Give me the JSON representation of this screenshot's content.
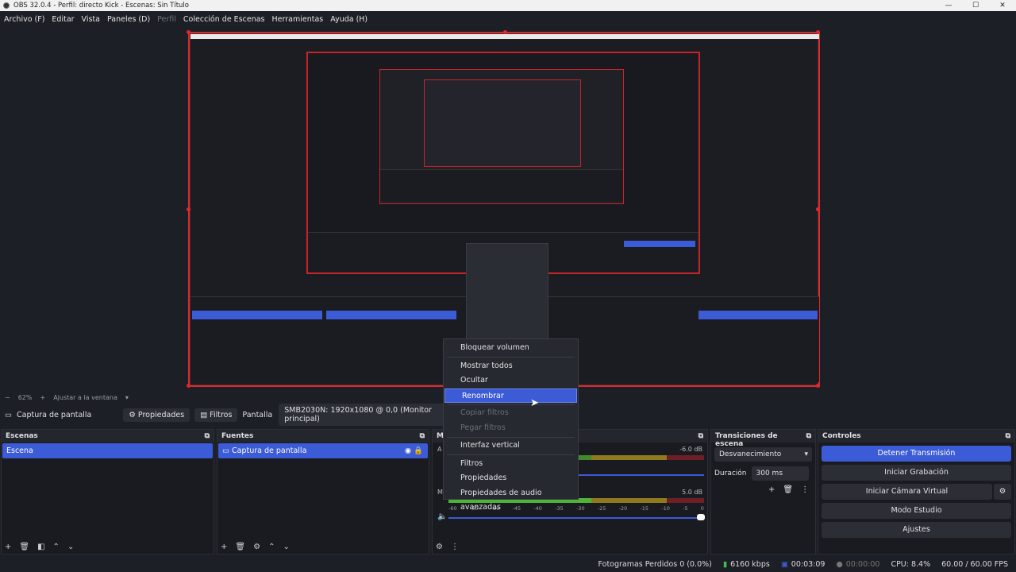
{
  "window": {
    "title": "OBS 32.0.4 - Perfil: directo Kick - Escenas: Sin Título",
    "min": "—",
    "max": "☐",
    "close": "✕"
  },
  "menubar": {
    "items": [
      "Archivo (F)",
      "Editar",
      "Vista",
      "Paneles (D)",
      "Perfil",
      "Colección de Escenas",
      "Herramientas",
      "Ayuda (H)"
    ]
  },
  "zoom": {
    "minus": "−",
    "value": "62%",
    "plus": "+",
    "fit": "Ajustar a la ventana"
  },
  "source_toolbar": {
    "source": "Captura de pantalla",
    "properties": "Propiedades",
    "filters": "Filtros",
    "display_label": "Pantalla",
    "display_value": "SMB2030N: 1920x1080 @ 0,0 (Monitor principal)"
  },
  "scenes": {
    "title": "Escenas",
    "items": [
      "Escena"
    ]
  },
  "sources": {
    "title": "Fuentes",
    "items": [
      "Captura de pantalla"
    ]
  },
  "mixer": {
    "title": "M",
    "track1": {
      "label": "A",
      "db": "-6.0 dB"
    },
    "track2": {
      "label": "M",
      "db": "5.0 dB"
    },
    "scale": [
      "-60",
      "-55",
      "-50",
      "-45",
      "-40",
      "-35",
      "-30",
      "-25",
      "-20",
      "-15",
      "-10",
      "-5",
      "0"
    ]
  },
  "transitions": {
    "title": "Transiciones de escena",
    "type": "Desvanecimiento",
    "duration_label": "Duración",
    "duration_value": "300 ms"
  },
  "controls": {
    "title": "Controles",
    "buttons": [
      "Detener Transmisión",
      "Iniciar Grabación",
      "Iniciar Cámara Virtual",
      "Modo Estudio",
      "Ajustes"
    ]
  },
  "context_menu": {
    "items": [
      {
        "label": "Bloquear volumen",
        "state": "normal"
      },
      {
        "label": "Mostrar todos",
        "state": "normal"
      },
      {
        "label": "Ocultar",
        "state": "normal"
      },
      {
        "label": "Renombrar",
        "state": "highlighted"
      },
      {
        "label": "Copiar filtros",
        "state": "disabled"
      },
      {
        "label": "Pegar filtros",
        "state": "disabled"
      },
      {
        "label": "Interfaz vertical",
        "state": "normal"
      },
      {
        "label": "Filtros",
        "state": "normal"
      },
      {
        "label": "Propiedades",
        "state": "normal"
      },
      {
        "label": "Propiedades de audio avanzadas",
        "state": "normal"
      }
    ]
  },
  "status": {
    "dropped": "Fotogramas Perdidos 0 (0.0%)",
    "bitrate": "6160 kbps",
    "stream_time": "00:03:09",
    "rec_time": "00:00:00",
    "cpu": "CPU: 8.4%",
    "fps": "60.00 / 60.00 FPS"
  },
  "colors": {
    "accent": "#3c5bd6",
    "selection_border": "#e3262b",
    "meter_green": "#3f8a2b",
    "meter_yellow": "#8f7a1e",
    "meter_red": "#6d1f25"
  }
}
